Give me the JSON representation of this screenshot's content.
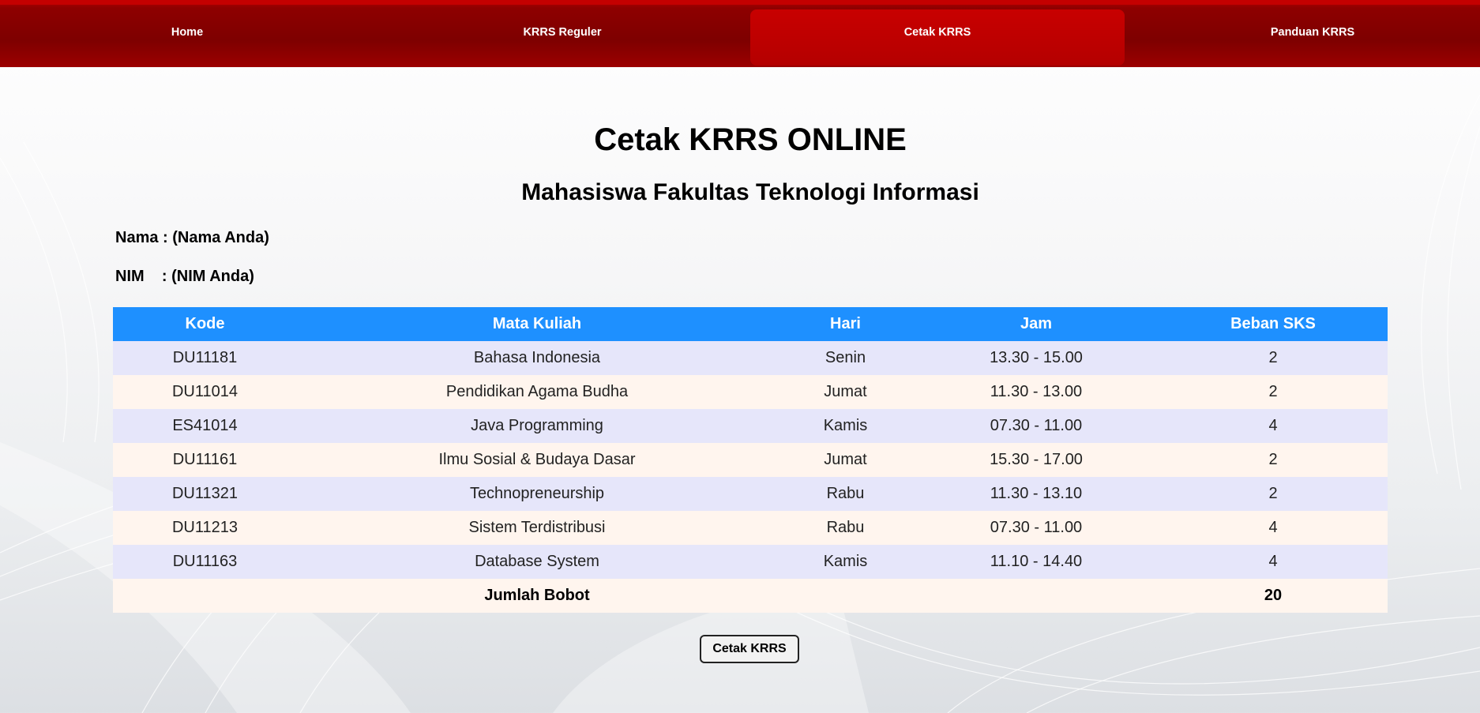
{
  "nav": {
    "items": [
      {
        "label": "Home",
        "active": false
      },
      {
        "label": "KRRS Reguler",
        "active": false
      },
      {
        "label": "Cetak KRRS",
        "active": true
      },
      {
        "label": "Panduan KRRS",
        "active": false
      }
    ],
    "colors": {
      "bar": "#7e0000",
      "active": "#b40000",
      "text": "#ffffff"
    }
  },
  "page": {
    "title": "Cetak KRRS ONLINE",
    "subtitle": "Mahasiswa Fakultas Teknologi Informasi"
  },
  "student": {
    "nama_line": "Nama : (Nama Anda)",
    "nim_line": "NIM    : (NIM Anda)"
  },
  "table": {
    "headers": [
      "Kode",
      "Mata Kuliah",
      "Hari",
      "Jam",
      "Beban SKS"
    ],
    "rows": [
      [
        "DU11181",
        "Bahasa Indonesia",
        "Senin",
        "13.30 - 15.00",
        "2"
      ],
      [
        "DU11014",
        "Pendidikan Agama Budha",
        "Jumat",
        "11.30 - 13.00",
        "2"
      ],
      [
        "ES41014",
        "Java Programming",
        "Kamis",
        "07.30 - 11.00",
        "4"
      ],
      [
        "DU11161",
        "Ilmu Sosial & Budaya Dasar",
        "Jumat",
        "15.30 - 17.00",
        "2"
      ],
      [
        "DU11321",
        "Technopreneurship",
        "Rabu",
        "11.30 - 13.10",
        "2"
      ],
      [
        "DU11213",
        "Sistem Terdistribusi",
        "Rabu",
        "07.30 - 11.00",
        "4"
      ],
      [
        "DU11163",
        "Database System",
        "Kamis",
        "11.10 - 14.40",
        "4"
      ]
    ],
    "total_label": "Jumlah Bobot",
    "total_value": "20",
    "colors": {
      "header": "#1e90ff",
      "row_odd": "#e6e6fa",
      "row_even": "#fff5ee"
    }
  },
  "actions": {
    "print_label": "Cetak KRRS"
  }
}
